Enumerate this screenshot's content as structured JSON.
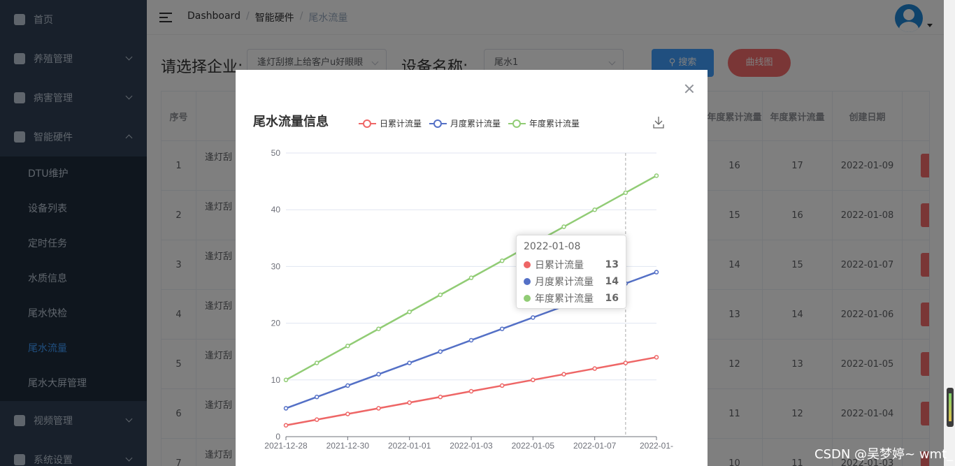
{
  "sidebar": {
    "items": [
      {
        "label": "首页",
        "icon": "dashboard-icon"
      },
      {
        "label": "养殖管理",
        "icon": "fish-icon"
      },
      {
        "label": "病害管理",
        "icon": "bug-icon"
      },
      {
        "label": "智能硬件",
        "icon": "clipboard-icon"
      }
    ],
    "sub_items": [
      "DTU维护",
      "设备列表",
      "定时任务",
      "水质信息",
      "尾水快检",
      "尾水流量",
      "尾水大屏管理"
    ],
    "active_sub": "尾水流量",
    "bottom_items": [
      {
        "label": "视频管理",
        "icon": "video-icon"
      },
      {
        "label": "系统设置",
        "icon": "gear-icon"
      }
    ]
  },
  "navbar": {
    "breadcrumb": [
      "Dashboard",
      "智能硬件",
      "尾水流量"
    ],
    "separator": "/"
  },
  "filter": {
    "company_label": "请选择企业:",
    "company_value": "逢灯刮擦上给客户u好眼眼",
    "device_label": "设备名称:",
    "device_value": "尾水1",
    "search_label": "搜索",
    "curve_label": "曲线图"
  },
  "table": {
    "headers": [
      "序号",
      "年度累计流量",
      "年度累计流量",
      "创建日期"
    ],
    "rows": [
      {
        "index": "1",
        "name": "逢灯刮",
        "c1": "16",
        "c2": "17",
        "date": "2022-01-09"
      },
      {
        "index": "2",
        "name": "逢灯刮",
        "c1": "15",
        "c2": "16",
        "date": "2022-01-08"
      },
      {
        "index": "3",
        "name": "逢灯刮",
        "c1": "14",
        "c2": "15",
        "date": "2022-01-07"
      },
      {
        "index": "4",
        "name": "逢灯刮",
        "c1": "13",
        "c2": "14",
        "date": "2022-01-06"
      },
      {
        "index": "5",
        "name": "逢灯刮",
        "c1": "12",
        "c2": "13",
        "date": "2022-01-05"
      },
      {
        "index": "6",
        "name": "逢灯刮",
        "c1": "11",
        "c2": "12",
        "date": "2022-01-04"
      },
      {
        "index": "7",
        "name": "逢灯刮",
        "c1": "10",
        "c2": "11",
        "date": "2022-01-03"
      }
    ]
  },
  "chart_data": {
    "type": "line",
    "title": "尾水流量信息",
    "x": [
      "2021-12-28",
      "2021-12-29",
      "2021-12-30",
      "2021-12-31",
      "2022-01-01",
      "2022-01-02",
      "2022-01-03",
      "2022-01-04",
      "2022-01-05",
      "2022-01-06",
      "2022-01-07",
      "2022-01-08",
      "2022-01-09"
    ],
    "x_tick_labels": [
      "2021-12-28",
      "2021-12-30",
      "2022-01-01",
      "2022-01-03",
      "2022-01-05",
      "2022-01-07",
      "2022-01-"
    ],
    "series": [
      {
        "name": "日累计流量",
        "color": "#ee6666",
        "values": [
          2,
          3,
          4,
          5,
          6,
          7,
          8,
          9,
          10,
          11,
          12,
          13,
          14
        ]
      },
      {
        "name": "月度累计流量",
        "color": "#5470c6",
        "values": [
          5,
          7,
          9,
          11,
          13,
          15,
          17,
          19,
          21,
          23,
          25,
          27,
          29
        ]
      },
      {
        "name": "年度累计流量",
        "color": "#91cc75",
        "values": [
          10,
          13,
          16,
          19,
          22,
          25,
          28,
          31,
          34,
          37,
          40,
          43,
          46
        ]
      }
    ],
    "ylim": [
      0,
      50
    ],
    "y_ticks": [
      "0",
      "10",
      "20",
      "30",
      "40",
      "50"
    ],
    "grid": true,
    "legend_position": "top"
  },
  "tooltip": {
    "title": "2022-01-08",
    "rows": [
      {
        "name": "日累计流量",
        "value": "13",
        "color": "#ee6666"
      },
      {
        "name": "月度累计流量",
        "value": "14",
        "color": "#5470c6"
      },
      {
        "name": "年度累计流量",
        "value": "16",
        "color": "#91cc75"
      }
    ]
  },
  "watermark": "CSDN @吴梦婷~ wmt_"
}
